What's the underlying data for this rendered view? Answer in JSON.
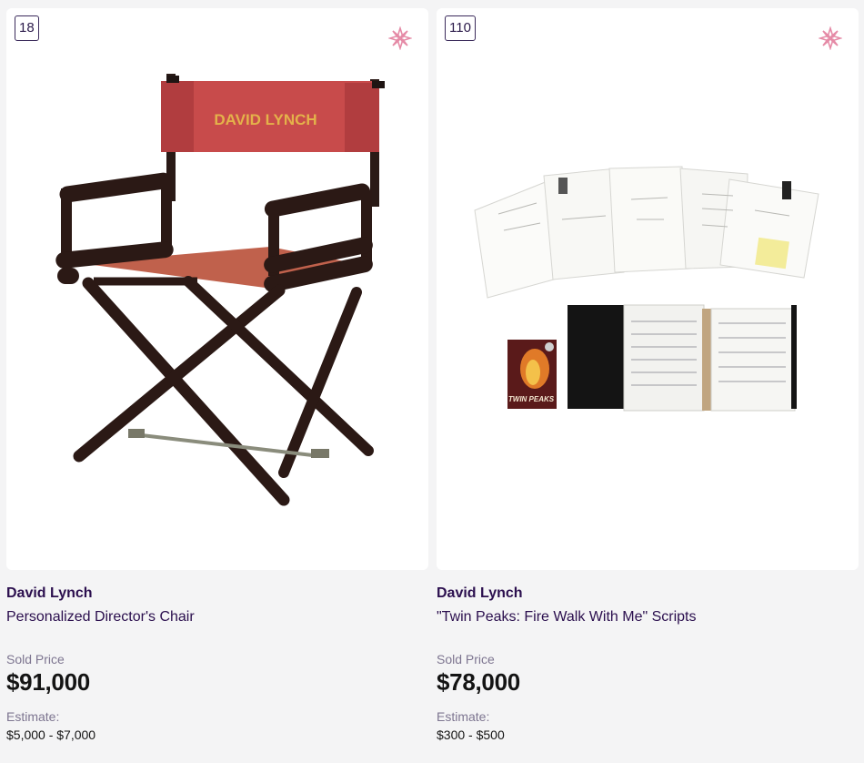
{
  "lots": [
    {
      "lot_number": "18",
      "artist": "David Lynch",
      "title": "Personalized Director's Chair",
      "sold_label": "Sold Price",
      "price": "$91,000",
      "estimate_label": "Estimate:",
      "estimate": "$5,000 - $7,000",
      "image_text": "DAVID LYNCH",
      "favorite_icon": "asterisk-flower-icon"
    },
    {
      "lot_number": "110",
      "artist": "David Lynch",
      "title": "\"Twin Peaks: Fire Walk With Me\" Scripts",
      "sold_label": "Sold Price",
      "price": "$78,000",
      "estimate_label": "Estimate:",
      "estimate": "$300 - $500",
      "image_text": "TWIN PEAKS",
      "favorite_icon": "asterisk-flower-icon"
    }
  ],
  "colors": {
    "accent_pink": "#e58aa6",
    "title_purple": "#2b0f4e",
    "muted": "#7d7590"
  }
}
